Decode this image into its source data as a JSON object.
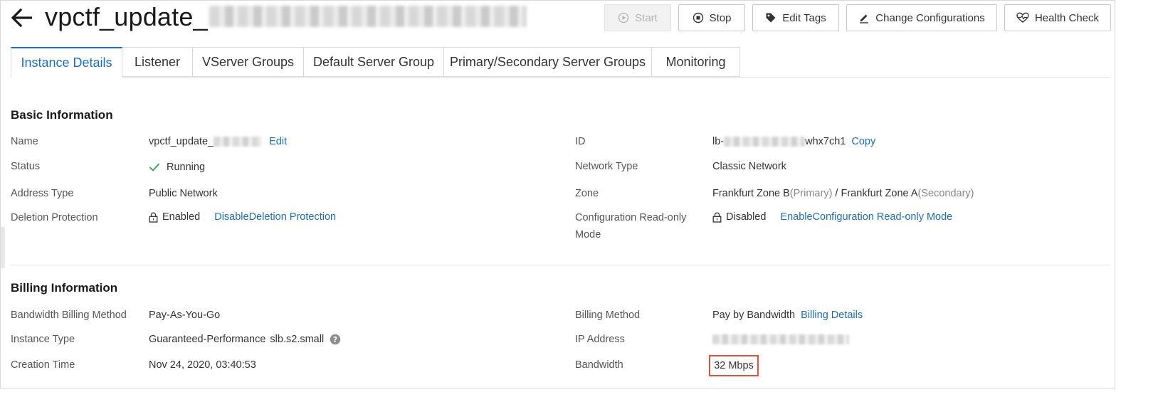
{
  "header": {
    "title": "vpctf_update_"
  },
  "actions": {
    "start": "Start",
    "stop": "Stop",
    "edit_tags": "Edit Tags",
    "change_config": "Change Configurations",
    "health_check": "Health Check"
  },
  "tabs": [
    {
      "label": "Instance Details",
      "active": true
    },
    {
      "label": "Listener"
    },
    {
      "label": "VServer Groups"
    },
    {
      "label": "Default Server Group"
    },
    {
      "label": "Primary/Secondary Server Groups"
    },
    {
      "label": "Monitoring"
    }
  ],
  "basic": {
    "title": "Basic Information",
    "name_label": "Name",
    "name_value": "vpctf_update_",
    "name_action": "Edit",
    "status_label": "Status",
    "status_value": "Running",
    "address_type_label": "Address Type",
    "address_type_value": "Public Network",
    "deletion_label": "Deletion Protection",
    "deletion_value": "Enabled",
    "deletion_action": "DisableDeletion Protection",
    "id_label": "ID",
    "id_prefix": "lb-",
    "id_suffix": "whx7ch1",
    "id_action": "Copy",
    "network_type_label": "Network Type",
    "network_type_value": "Classic Network",
    "zone_label": "Zone",
    "zone_primary": "Frankfurt Zone B",
    "zone_primary_tag": "(Primary)",
    "zone_sep": " / ",
    "zone_secondary": "Frankfurt Zone A",
    "zone_secondary_tag": "(Secondary)",
    "config_ro_label_1": "Configuration Read-only",
    "config_ro_label_2": "Mode",
    "config_ro_value": "Disabled",
    "config_ro_action": "EnableConfiguration Read-only Mode"
  },
  "billing": {
    "title": "Billing Information",
    "bw_method_label": "Bandwidth Billing Method",
    "bw_method_value": "Pay-As-You-Go",
    "instance_type_label": "Instance Type",
    "instance_type_value": "Guaranteed-Performance",
    "instance_type_spec": "slb.s2.small",
    "creation_label": "Creation Time",
    "creation_value": "Nov 24, 2020, 03:40:53",
    "billing_method_label": "Billing Method",
    "billing_method_value": "Pay by Bandwidth",
    "billing_method_action": "Billing Details",
    "ip_label": "IP Address",
    "bandwidth_label": "Bandwidth",
    "bandwidth_value": "32 Mbps"
  },
  "colors": {
    "link": "#1b6fb8",
    "success": "#2ea44f",
    "highlight": "#d9543a"
  },
  "icons": [
    "back-arrow-icon",
    "play-icon",
    "stop-icon",
    "tag-icon",
    "pencil-icon",
    "heartbeat-icon",
    "check-icon",
    "lock-icon",
    "help-icon"
  ]
}
